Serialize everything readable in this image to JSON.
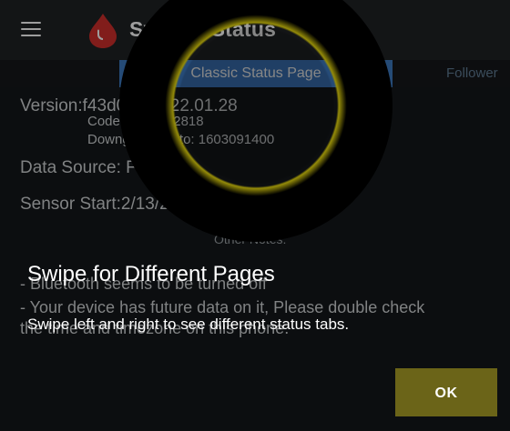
{
  "appbar": {
    "title": "System Status",
    "menu_icon": "menu-icon",
    "logo_icon": "blood-drop-icon",
    "logo_color": "#d0302c"
  },
  "tabs": {
    "active_label": "Classic Status Page",
    "next_label": "Follower"
  },
  "status": {
    "version": "Version:f43d037-2022.01.28",
    "code": "Code: 2122012818",
    "downgradable": "Downgradable to: 1603091400",
    "data_source": "Data Source: Follower",
    "sensor_start": "Sensor Start:2/13/22 00:00 (4d 15h)",
    "other_notes_label": "Other Notes:",
    "note1": "- Bluetooth seems to be turned off",
    "note2a": "- Your device has future data on it, Please double check",
    "note2b": "the time and timezone on this phone."
  },
  "tip": {
    "title": "Swipe for Different Pages",
    "description": "Swipe left and right to see different status tabs.",
    "ok_label": "OK",
    "accent_color": "#f1e20f"
  }
}
